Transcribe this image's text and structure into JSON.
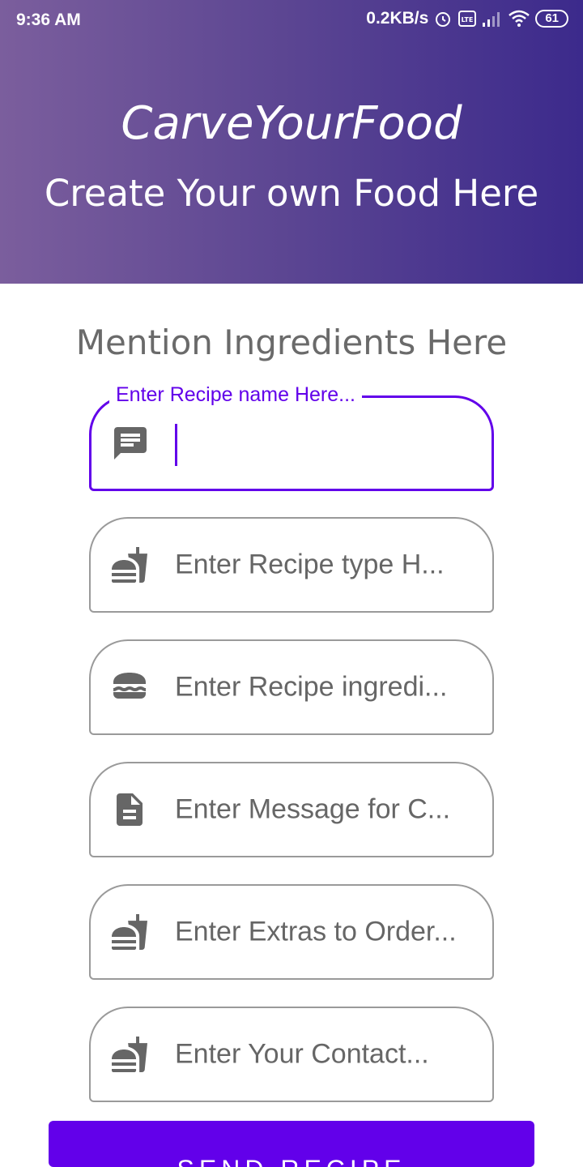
{
  "status_bar": {
    "time": "9:36 AM",
    "network_speed": "0.2KB/s",
    "battery_level": "61",
    "icons": [
      "alarm-icon",
      "volte-icon",
      "signal-icon",
      "wifi-icon",
      "battery-icon"
    ]
  },
  "header": {
    "title": "CarveYourFood",
    "subtitle": "Create Your own Food Here"
  },
  "form": {
    "section_title": "Mention Ingredients Here",
    "fields": [
      {
        "label": "Enter Recipe name Here...",
        "value": "",
        "icon": "message-icon",
        "focused": true
      },
      {
        "placeholder": "Enter Recipe type H...",
        "icon": "fastfood-icon"
      },
      {
        "placeholder": "Enter Recipe ingredi...",
        "icon": "burger-icon"
      },
      {
        "placeholder": "Enter Message for C...",
        "icon": "document-icon"
      },
      {
        "placeholder": "Enter Extras to Order...",
        "icon": "fastfood-icon"
      },
      {
        "placeholder": "Enter Your Contact...",
        "icon": "fastfood-icon"
      }
    ],
    "submit_label": "SEND RECIPE"
  },
  "colors": {
    "accent": "#6200ea",
    "header_gradient_start": "#7b5e9d",
    "header_gradient_end": "#3c2a8c",
    "icon_gray": "#666666"
  }
}
